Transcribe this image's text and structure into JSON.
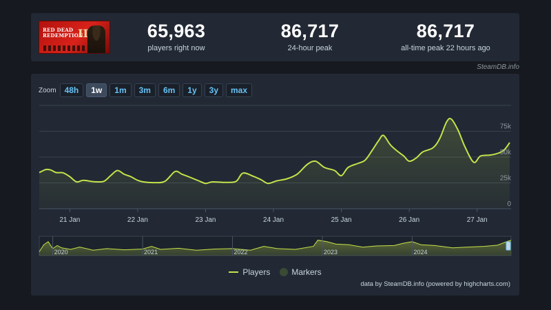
{
  "game": {
    "cover_title": "Red Dead Redemption",
    "cover_numeral": "II"
  },
  "stats": [
    {
      "value": "65,963",
      "label": "players right now"
    },
    {
      "value": "86,717",
      "label": "24-hour peak"
    },
    {
      "value": "86,717",
      "label": "all-time peak 22 hours ago"
    }
  ],
  "source_badge": "SteamDB.info",
  "zoom": {
    "label": "Zoom",
    "options": [
      "48h",
      "1w",
      "1m",
      "3m",
      "6m",
      "1y",
      "3y",
      "max"
    ],
    "selected": "1w"
  },
  "legend": {
    "players": "Players",
    "markers": "Markers"
  },
  "credit": "data by SteamDB.info (powered by highcharts.com)",
  "colors": {
    "line": "#c5e34a",
    "background": "#222934",
    "page": "#16191f",
    "link": "#67c1f5"
  },
  "chart_data": {
    "type": "area",
    "series_name": "Players",
    "ylim": [
      0,
      100000
    ],
    "y_ticks": [
      0,
      25000,
      50000,
      75000
    ],
    "y_tick_labels": [
      "0",
      "25k",
      "50k",
      "75k"
    ],
    "x_ticks": [
      1,
      2,
      3,
      4,
      5,
      6,
      7
    ],
    "x_tick_labels": [
      "21 Jan",
      "22 Jan",
      "23 Jan",
      "24 Jan",
      "25 Jan",
      "26 Jan",
      "27 Jan"
    ],
    "xlim": [
      0.55,
      7.5
    ],
    "x_unit": "days since 20 Jan 00:00",
    "points": [
      [
        0.55,
        35000
      ],
      [
        0.65,
        38000
      ],
      [
        0.72,
        37500
      ],
      [
        0.8,
        35000
      ],
      [
        0.9,
        34800
      ],
      [
        1.0,
        31000
      ],
      [
        1.1,
        26000
      ],
      [
        1.2,
        27500
      ],
      [
        1.35,
        26200
      ],
      [
        1.5,
        26500
      ],
      [
        1.6,
        32000
      ],
      [
        1.7,
        37000
      ],
      [
        1.8,
        33500
      ],
      [
        1.9,
        31000
      ],
      [
        2.0,
        27500
      ],
      [
        2.1,
        25800
      ],
      [
        2.25,
        25300
      ],
      [
        2.4,
        26500
      ],
      [
        2.55,
        36000
      ],
      [
        2.65,
        33500
      ],
      [
        2.75,
        31000
      ],
      [
        2.9,
        27000
      ],
      [
        3.0,
        24500
      ],
      [
        3.1,
        26000
      ],
      [
        3.3,
        25500
      ],
      [
        3.45,
        26500
      ],
      [
        3.55,
        34500
      ],
      [
        3.7,
        31500
      ],
      [
        3.82,
        28000
      ],
      [
        3.92,
        24500
      ],
      [
        4.05,
        27000
      ],
      [
        4.2,
        29000
      ],
      [
        4.35,
        33500
      ],
      [
        4.5,
        43000
      ],
      [
        4.62,
        46000
      ],
      [
        4.75,
        40000
      ],
      [
        4.9,
        37000
      ],
      [
        5.0,
        32000
      ],
      [
        5.1,
        40000
      ],
      [
        5.25,
        44000
      ],
      [
        5.35,
        47000
      ],
      [
        5.45,
        56000
      ],
      [
        5.55,
        66000
      ],
      [
        5.62,
        71000
      ],
      [
        5.72,
        62000
      ],
      [
        5.82,
        56000
      ],
      [
        5.92,
        51000
      ],
      [
        6.0,
        46000
      ],
      [
        6.1,
        49000
      ],
      [
        6.2,
        55000
      ],
      [
        6.35,
        59000
      ],
      [
        6.45,
        68000
      ],
      [
        6.55,
        84000
      ],
      [
        6.62,
        86717
      ],
      [
        6.72,
        76000
      ],
      [
        6.82,
        60000
      ],
      [
        6.95,
        45000
      ],
      [
        7.05,
        51000
      ],
      [
        7.2,
        52000
      ],
      [
        7.32,
        54000
      ],
      [
        7.4,
        57000
      ],
      [
        7.48,
        64000
      ]
    ],
    "navigator": {
      "x_tick_labels": [
        "2020",
        "2021",
        "2022",
        "2023",
        "2024"
      ],
      "x_ticks": [
        2020.0,
        2021.0,
        2022.0,
        2023.0,
        2024.0
      ],
      "xlim": [
        2019.85,
        2025.1
      ],
      "points": [
        [
          2019.85,
          5000
        ],
        [
          2019.9,
          14000
        ],
        [
          2019.95,
          18000
        ],
        [
          2020.0,
          9000
        ],
        [
          2020.05,
          13000
        ],
        [
          2020.1,
          10000
        ],
        [
          2020.2,
          8000
        ],
        [
          2020.3,
          11000
        ],
        [
          2020.45,
          7000
        ],
        [
          2020.6,
          9000
        ],
        [
          2020.8,
          7500
        ],
        [
          2021.0,
          8500
        ],
        [
          2021.1,
          12000
        ],
        [
          2021.2,
          8000
        ],
        [
          2021.4,
          9500
        ],
        [
          2021.6,
          7000
        ],
        [
          2021.8,
          8500
        ],
        [
          2022.0,
          9000
        ],
        [
          2022.2,
          7000
        ],
        [
          2022.35,
          12000
        ],
        [
          2022.5,
          9000
        ],
        [
          2022.7,
          8000
        ],
        [
          2022.9,
          12000
        ],
        [
          2022.95,
          20000
        ],
        [
          2023.05,
          18000
        ],
        [
          2023.15,
          15000
        ],
        [
          2023.3,
          14000
        ],
        [
          2023.45,
          11000
        ],
        [
          2023.6,
          12500
        ],
        [
          2023.8,
          13000
        ],
        [
          2023.9,
          16000
        ],
        [
          2024.0,
          18000
        ],
        [
          2024.1,
          14000
        ],
        [
          2024.25,
          13000
        ],
        [
          2024.45,
          10000
        ],
        [
          2024.6,
          11000
        ],
        [
          2024.8,
          12000
        ],
        [
          2024.95,
          13500
        ],
        [
          2025.05,
          18000
        ],
        [
          2025.1,
          20000
        ]
      ],
      "ylim": [
        0,
        25000
      ]
    }
  }
}
